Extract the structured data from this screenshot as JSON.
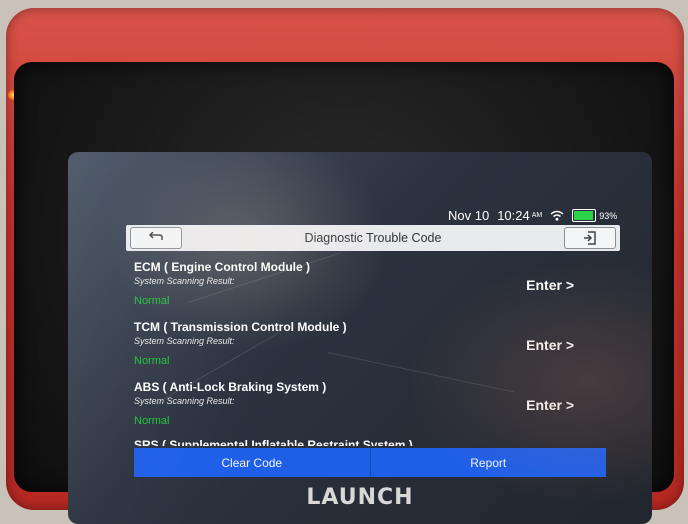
{
  "status": {
    "date": "Nov 10",
    "time": "10:24",
    "ampm": "AM",
    "battery": "93%"
  },
  "header": {
    "title": "Diagnostic Trouble Code",
    "back_icon": "back-arrow-icon",
    "exit_icon": "exit-icon"
  },
  "modules": [
    {
      "name": "ECM ( Engine Control Module )",
      "label": "System Scanning Result:",
      "result": "Normal",
      "action": "Enter >"
    },
    {
      "name": "TCM ( Transmission Control Module )",
      "label": "System Scanning Result:",
      "result": "Normal",
      "action": "Enter >"
    },
    {
      "name": "ABS ( Anti-Lock Braking System )",
      "label": "System Scanning Result:",
      "result": "Normal",
      "action": "Enter >"
    }
  ],
  "partial_item": "SRS ( Supplemental Inflatable Restraint System )",
  "actions": {
    "clear_code": "Clear Code",
    "report": "Report"
  },
  "brand": "LAUNCH",
  "colors": {
    "result_green": "#22c13a",
    "button_blue": "#1f5fe8",
    "housing_red": "#c8322c"
  }
}
